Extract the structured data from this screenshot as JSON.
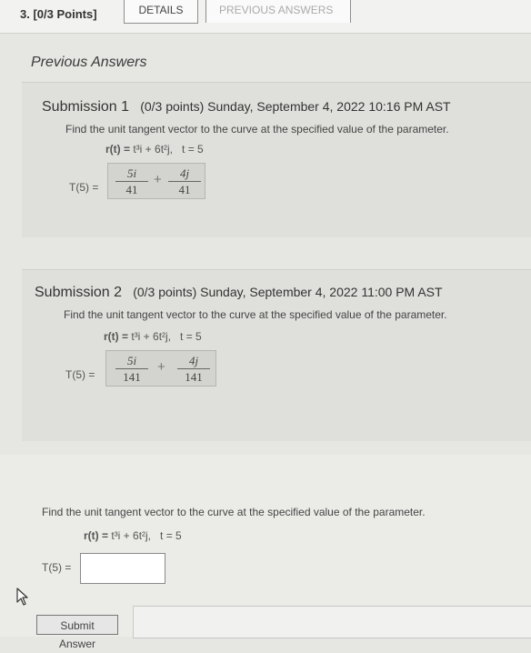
{
  "header": {
    "question_number": "3.",
    "points": "[0/3 Points]",
    "tabs": [
      {
        "label": "DETAILS"
      },
      {
        "label": "PREVIOUS ANSWERS"
      }
    ]
  },
  "previous_answers": {
    "heading": "Previous Answers",
    "submissions": [
      {
        "name": "Submission 1",
        "meta": "(0/3 points) Sunday, September 4, 2022 10:16 PM AST",
        "prompt": "Find the unit tangent vector to the curve at the specified value of the parameter.",
        "formula": {
          "lhs": "r(t) =",
          "body": "t³i + 6t²j,",
          "param": "t = 5"
        },
        "t_label": "T(5) =",
        "answer": {
          "num1": "5i",
          "den1": "41",
          "plus": "+",
          "num2": "4j",
          "den2": "41"
        }
      },
      {
        "name": "Submission 2",
        "meta": "(0/3 points) Sunday, September 4, 2022 11:00 PM AST",
        "prompt": "Find the unit tangent vector to the curve at the specified value of the parameter.",
        "formula": {
          "lhs": "r(t) =",
          "body": "t³i + 6t²j,",
          "param": "t = 5"
        },
        "t_label": "T(5) =",
        "answer": {
          "num1": "5i",
          "den1": "141",
          "plus": "+",
          "num2": "4j",
          "den2": "141"
        }
      }
    ]
  },
  "current": {
    "prompt": "Find the unit tangent vector to the curve at the specified value of the parameter.",
    "formula": {
      "lhs": "r(t) =",
      "body": "t³i + 6t²j,",
      "param": "t = 5"
    },
    "t_label": "T(5) =",
    "input_value": "",
    "submit_label": "Submit Answer"
  },
  "icons": {
    "cursor": "mouse-pointer-icon"
  }
}
